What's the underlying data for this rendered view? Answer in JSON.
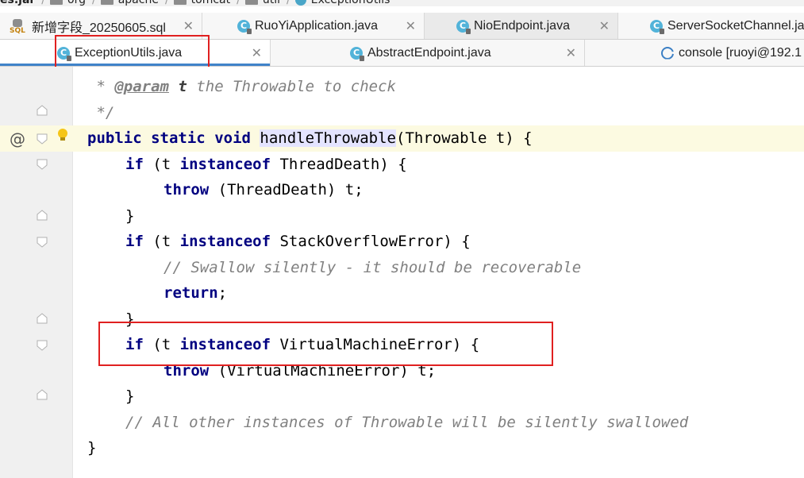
{
  "breadcrumb": {
    "items": [
      "es.jar",
      "org",
      "apache",
      "tomcat",
      "util",
      "ExceptionUtils"
    ]
  },
  "tabs_row1": [
    {
      "label": "新增字段_20250605.sql",
      "icon": "sql-file-icon"
    },
    {
      "label": "RuoYiApplication.java",
      "icon": "java-class-icon"
    },
    {
      "label": "NioEndpoint.java",
      "icon": "java-class-icon"
    },
    {
      "label": "ServerSocketChannel.java",
      "icon": "java-class-icon"
    }
  ],
  "tabs_row2": [
    {
      "label": "ExceptionUtils.java",
      "icon": "java-class-icon",
      "active": true
    },
    {
      "label": "AbstractEndpoint.java",
      "icon": "java-class-icon"
    },
    {
      "label": "console [ruoyi@192.1",
      "icon": "console-icon"
    }
  ],
  "code": {
    "l1": {
      "star": " * ",
      "tag": "@param",
      "sp": " ",
      "param": "t",
      "rest": " the Throwable to check"
    },
    "l2": " */",
    "l3": {
      "k1": "public",
      "k2": "static",
      "k3": "void",
      "name": "handleThrowable",
      "rest": "(Throwable t) {"
    },
    "l4": {
      "k": "if",
      "a": " (t ",
      "k2": "instanceof",
      "b": " ThreadDeath) {"
    },
    "l5": {
      "k": "throw",
      "rest": " (ThreadDeath) t;"
    },
    "l6": "}",
    "l7": {
      "k": "if",
      "a": " (t ",
      "k2": "instanceof",
      "b": " StackOverflowError) {"
    },
    "l8": "// Swallow silently - it should be recoverable",
    "l9": {
      "k": "return",
      "rest": ";"
    },
    "l10": "}",
    "l11": {
      "k": "if",
      "a": " (t ",
      "k2": "instanceof",
      "b": " VirtualMachineError) {"
    },
    "l12": {
      "k": "throw",
      "rest": " (VirtualMachineError) t;"
    },
    "l13": "}",
    "l14": "// All other instances of Throwable will be silently swallowed",
    "l15": "}"
  },
  "gutter": {
    "override_marker": "@"
  },
  "colors": {
    "keyword": "#000080",
    "comment": "#808080",
    "highlight": "#e02020",
    "active_tab": "#4083c9"
  }
}
